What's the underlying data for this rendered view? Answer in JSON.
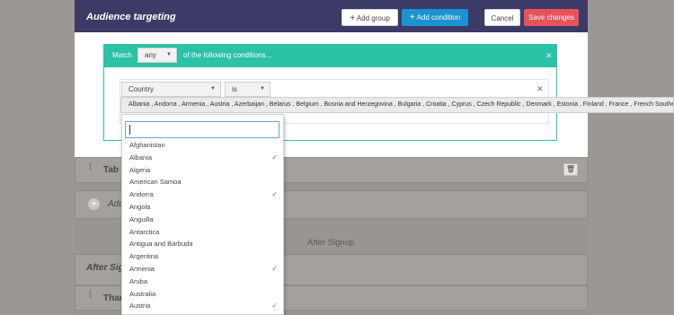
{
  "modal": {
    "title": "Audience targeting",
    "add_group_label": "Add group",
    "add_condition_label": "Add condition",
    "cancel_label": "Cancel",
    "save_label": "Save changes"
  },
  "condition_group": {
    "match_label": "Match",
    "match_value": "any",
    "following_label": "of the following conditions..."
  },
  "condition": {
    "field_value": "Country",
    "operator_value": "is",
    "selected_countries": "Albania , Andorra , Armenia , Austria , Azerbaijan , Belarus , Belgium , Bosnia and Herzegovina , Bulgaria , Croatia , Cyprus , Czech Republic , Denmark , Estonia , Finland , France , French Southern"
  },
  "dropdown": {
    "search_placeholder": "",
    "options": [
      {
        "label": "Afghanistan",
        "checked": false
      },
      {
        "label": "Albania",
        "checked": true
      },
      {
        "label": "Algeria",
        "checked": false
      },
      {
        "label": "American Samoa",
        "checked": false
      },
      {
        "label": "Andorra",
        "checked": true
      },
      {
        "label": "Angola",
        "checked": false
      },
      {
        "label": "Anguilla",
        "checked": false
      },
      {
        "label": "Antarctica",
        "checked": false
      },
      {
        "label": "Antigua and Barbuda",
        "checked": false
      },
      {
        "label": "Argentina",
        "checked": false
      },
      {
        "label": "Armenia",
        "checked": true
      },
      {
        "label": "Aruba",
        "checked": false
      },
      {
        "label": "Australia",
        "checked": false
      },
      {
        "label": "Austria",
        "checked": true
      }
    ]
  },
  "background": {
    "tab_row_label": "Tab D",
    "add_row_label": "Add",
    "after_signup_heading": "After Signup",
    "after_signup_section": "After Signu",
    "thanks_row_label": "Thank"
  }
}
